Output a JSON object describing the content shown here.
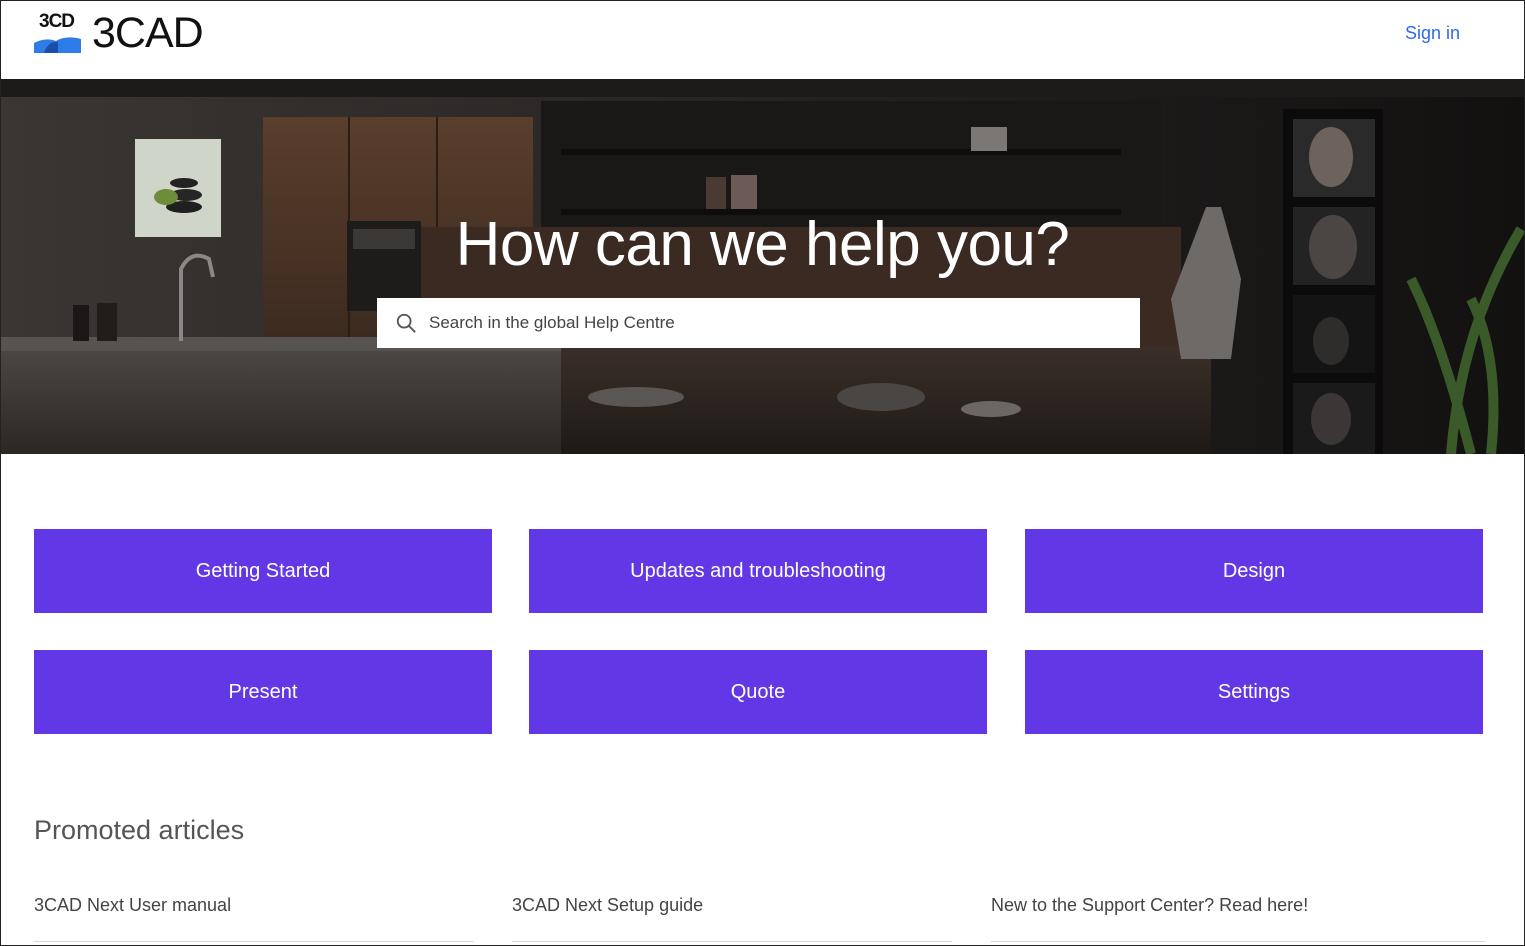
{
  "header": {
    "logo_mark_text": "3CD",
    "logo_word": "3CAD",
    "signin_label": "Sign in",
    "link_color": "#2e6be6"
  },
  "hero": {
    "title": "How can we help you?",
    "search_placeholder": "Search in the global Help Centre",
    "search_icon": "search-icon"
  },
  "categories": [
    {
      "label": "Getting Started"
    },
    {
      "label": "Updates and troubleshooting"
    },
    {
      "label": "Design"
    },
    {
      "label": "Present"
    },
    {
      "label": "Quote"
    },
    {
      "label": "Settings"
    }
  ],
  "category_color": "#6238e6",
  "promoted": {
    "title": "Promoted articles",
    "articles": [
      {
        "label": "3CAD Next User manual"
      },
      {
        "label": "3CAD Next Setup guide"
      },
      {
        "label": "New to the Support Center? Read here!"
      }
    ]
  }
}
